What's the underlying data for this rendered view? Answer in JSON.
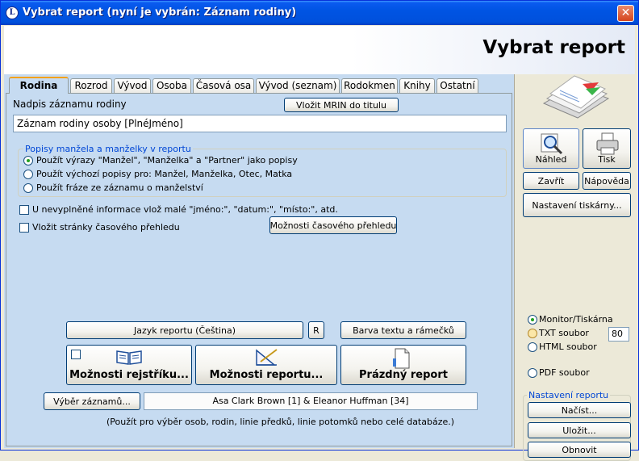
{
  "window": {
    "title": "Vybrat report (nyní je vybrán: Záznam rodiny)",
    "app_icon_letter": "L",
    "close_glyph": "✕"
  },
  "header": {
    "title": "Vybrat report"
  },
  "tabs": [
    {
      "label": "Rodina",
      "active": true
    },
    {
      "label": "Rozrod"
    },
    {
      "label": "Vývod"
    },
    {
      "label": "Osoba"
    },
    {
      "label": "Časová osa"
    },
    {
      "label": "Vývod (seznam)"
    },
    {
      "label": "Rodokmen"
    },
    {
      "label": "Knihy"
    },
    {
      "label": "Ostatní"
    }
  ],
  "form": {
    "title_label": "Nadpis záznamu rodiny",
    "insert_mrin_button": "Vložit MRIN do titulu",
    "title_value": "Záznam rodiny osoby [PlnéJméno]",
    "spouse_group_title": "Popisy manžela a manželky v reportu",
    "spouse_options": [
      "Použít výrazy \"Manžel\", \"Manželka\" a \"Partner\" jako popisy",
      "Použít výchozí popisy pro: Manžel, Manželka, Otec, Matka",
      "Použít fráze ze záznamu o manželství"
    ],
    "blank_info_check": "U nevyplněné informace vlož malé \"jméno:\", \"datum:\", \"místo:\", atd.",
    "timeline_check": "Vložit stránky časového přehledu",
    "timeline_options_button": "Možnosti časového přehledu",
    "language_button": "Jazyk reportu (Čeština)",
    "r_button": "R",
    "color_button": "Barva textu a rámečků",
    "index_options_button": "Možnosti rejstříku...",
    "report_options_button": "Možnosti reportu...",
    "blank_report_button": "Prázdný report",
    "record_select_button": "Výběr záznamů...",
    "record_select_value": "Asa Clark Brown [1] & Eleanor Huffman [34]",
    "record_select_hint": "(Použít pro výběr osob, rodin, linie předků, linie potomků nebo celé databáze.)"
  },
  "right": {
    "preview_button": "Náhled",
    "print_button": "Tisk",
    "close_button": "Zavřít",
    "help_button": "Nápověda",
    "printer_setup_button": "Nastavení tiskárny...",
    "output_options": [
      "Monitor/Tiskárna",
      "TXT soubor",
      "HTML soubor",
      "PDF soubor"
    ],
    "txt_width_value": "80",
    "settings_group_title": "Nastavení reportu",
    "load_button": "Načíst...",
    "save_button": "Uložit...",
    "reset_button": "Obnovit"
  },
  "colors": {
    "accent_tab": "#f2a01b",
    "panel_bg": "#c6dbf1",
    "group_title": "#0046d5"
  }
}
